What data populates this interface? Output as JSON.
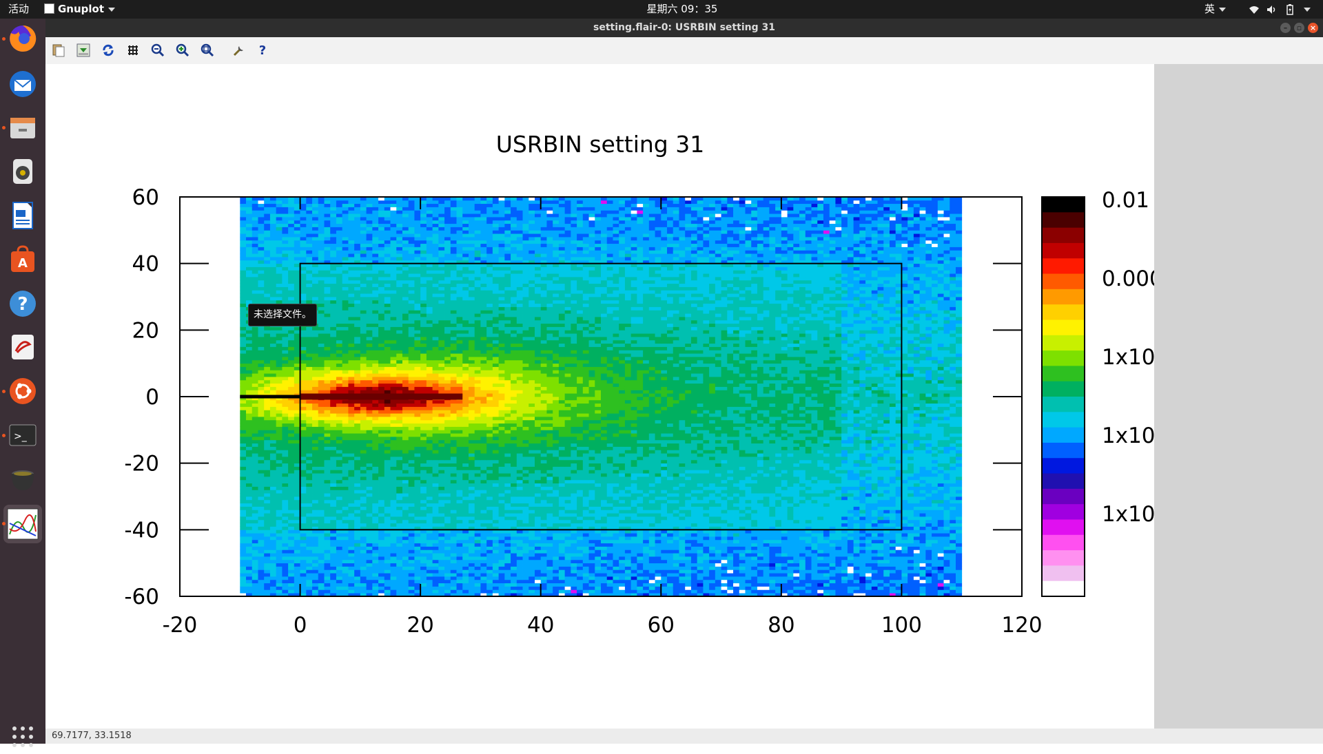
{
  "topbar": {
    "activities": "活动",
    "app_menu": "Gnuplot",
    "clock": "星期六 09：35",
    "input_method": "英"
  },
  "window": {
    "title": "setting.flair-0: USRBIN setting 31"
  },
  "dock": {
    "items": [
      "firefox-icon",
      "thunderbird-icon",
      "files-icon",
      "rhythmbox-icon",
      "writer-icon",
      "software-center-icon",
      "help-icon",
      "text-editor-icon",
      "ubuntu-icon",
      "terminal-icon",
      "cauldron-icon",
      "gnuplot-icon"
    ],
    "show_apps": "show-applications-icon"
  },
  "toolbar": {
    "buttons": [
      "copy-icon",
      "print-icon",
      "replot-icon",
      "grid-icon",
      "zoom-previous-icon",
      "zoom-next-icon",
      "autoscale-icon",
      "settings-icon",
      "help-icon"
    ]
  },
  "tooltip": "未选择文件。",
  "status": {
    "coords": "69.7177,  33.1518"
  },
  "chart_data": {
    "type": "heatmap",
    "title": "USRBIN setting 31",
    "xlim": [
      -20,
      120
    ],
    "ylim": [
      -60,
      60
    ],
    "x_ticks": [
      "-20",
      "0",
      "20",
      "40",
      "60",
      "80",
      "100",
      "120"
    ],
    "y_ticks": [
      "60",
      "40",
      "20",
      "0",
      "-20",
      "-40",
      "-60"
    ],
    "data_extent": {
      "x": [
        -10,
        110
      ],
      "y": [
        -60,
        60
      ]
    },
    "beam": {
      "x": [
        -10,
        27
      ],
      "y": 0
    },
    "inner_box": {
      "x": [
        0,
        100
      ],
      "y": [
        -40,
        40
      ]
    },
    "colorbar_labels": [
      "0.01",
      "0.000",
      "1x10",
      "1x10",
      "1x10"
    ],
    "colorbar_colors": [
      "#000000",
      "#4a0000",
      "#8b0000",
      "#c00000",
      "#ff1a00",
      "#ff5a00",
      "#ff9a00",
      "#ffd000",
      "#fff200",
      "#c8f000",
      "#7ee000",
      "#2ec020",
      "#00b060",
      "#00c0b0",
      "#00c8e8",
      "#00a8ff",
      "#0060ff",
      "#0018e0",
      "#2010b0",
      "#6a00c0",
      "#a000e0",
      "#e010f0",
      "#ff50f0",
      "#ff90f0",
      "#f0c0f0",
      "#ffffff"
    ],
    "grid": false
  }
}
